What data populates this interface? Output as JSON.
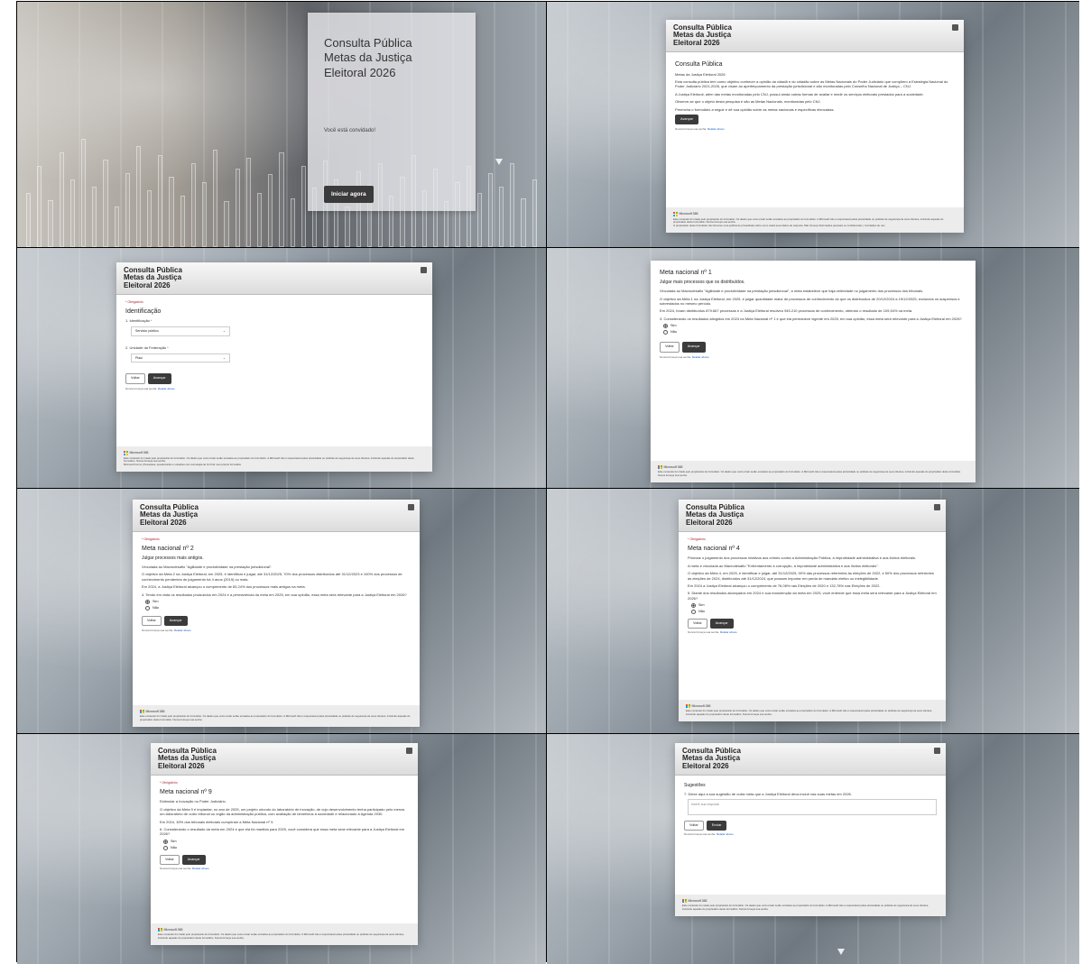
{
  "form": {
    "title_lines": [
      "Consulta Pública",
      "Metas da Justiça",
      "Eleitoral 2026"
    ],
    "cover_title": "Consulta Pública Metas da Justiça Eleitoral 2026",
    "invite": "Você está convidado!",
    "start_button": "Iniciar agora",
    "required_note": "* Obrigatório",
    "back_button": "Voltar",
    "next_button": "Avançar",
    "submit_button": "Enviar",
    "never_password": "Nunca forneça sua senha.",
    "report_abuse": "Relatar abuso",
    "yes": "Sim",
    "no": "Não"
  },
  "footer": {
    "brand": "Microsoft 365",
    "text1": "Este conteúdo foi criado pelo proprietário do formulário. Os dados que você enviar serão enviados ao proprietário do formulário. A Microsoft não é responsável pelas privacidade ou práticas de segurança de seus clientes, incluindo aquelas do proprietário deste formulário. Nunca forneça sua senha.",
    "text2": "Microsoft Forms | Pesquisas, questionários e votações com tecnologia de IA Criar meu próprio formulário",
    "text3": "O proprietário deste formulário não forneceu uma política de privacidade sobre como usará seus dados de resposta. Não forneça informações pessoais ou confidenciais. | Condições de uso"
  },
  "intro": {
    "heading": "Consulta Pública",
    "subheading": "Metas da Justiça Eleitoral 2026",
    "p1": "Esta consulta pública tem como objetivo conhecer a opinião da cidadã e do cidadão sobre as Metas Nacionais do Poder Judiciário que compõem a Estratégia Nacional do Poder Judiciário 2021-2026, que visam ao aperfeiçoamento da prestação jurisdicional e são monitoradas pelo Conselho Nacional de Justiça – CNJ.",
    "p2": "A Justiça Eleitoral, além das metas monitoradas pelo CNJ, possui ainda outras formas de avaliar e medir os serviços eleitorais prestados para a sociedade.",
    "p3": "Observe-se que o objeto desta pesquisa é são as Metas Nacionais, monitoradas pelo CNJ.",
    "p4": "Preencha o formulário a seguir e dê sua opinião sobre as metas nacionais e específicas elencadas."
  },
  "identification": {
    "heading": "Identificação",
    "q1": "1. Identificação",
    "q1_value": "Servidor público",
    "q2": "2. Unidade da Federação",
    "q2_value": "Piauí"
  },
  "meta1": {
    "heading": "Meta nacional nº 1",
    "subtitle": "Julgar mais processos que os distribuídos.",
    "p1": "Vinculada ao Macrodesafio \"Agilidade e produtividade na prestação jurisdicional\", a meta estabelece que haja celeridade no julgamento dos processos dos tribunais.",
    "p2": "O objetivo da Meta 1 na Justiça Eleitoral, em 2025, é julgar quantidade maior de processos de conhecimento do que os distribuídos de 20/12/2024 a 19/12/2025, excluídos os suspensos e sobrestados no mesmo período.",
    "p3": "Em 2024, foram distribuídos 879.667 processos e a Justiça Eleitoral resolveu 945.210 processos de conhecimento, obtendo o resultado de 109,54% na meta.",
    "q": "3. Considerando os resultados atingidos em 2024 na Meta Nacional nº 1 e que ela permanece vigente em 2025, em sua opinião, essa meta será relevante para a Justiça Eleitoral em 2026?"
  },
  "meta2": {
    "heading": "Meta nacional nº 2",
    "subtitle": "Julgar processos mais antigos.",
    "p1": "Vinculada ao Macrodesafio \"Agilidade e produtividade na prestação jurisdicional\".",
    "p2": "O objetivo da Meta 2 na Justiça Eleitoral, em 2025, é identificar e julgar, até 31/12/2025, 70% dos processos distribuídos até 31/12/2023 e 100% dos processos de conhecimento pendentes de julgamento há 4 anos (2019) ou mais.",
    "p3": "Em 2024, a Justiça Eleitoral alcançou o cumprimento de 83,24% dos processos mais antigos na meta.",
    "q": "4. Tendo em vista os resultados produzidos em 2024 e a permanência da meta em 2025, em sua opinião, essa meta será relevante para a Justiça Eleitoral em 2026?"
  },
  "meta4": {
    "heading": "Meta nacional nº 4",
    "p1": "Priorizar o julgamento dos processos relativos aos crimes contra a Administração Pública, à improbidade administrativa e aos ilícitos eleitorais.",
    "p2": "A meta é vinculada ao Macrodesafio \"Enfrentamento à corrupção, à improbidade administrativa e aos ilícitos eleitorais\".",
    "p3": "O objetivo da Meta 4, em 2025, é identificar e julgar, até 31/12/2025, 90% das processos referentes às eleições de 2022, e 50% dos processos referentes às eleições de 2024, distribuídos até 31/12/2024, que possam importar em perda de mandato eletivo ou inelegibilidade.",
    "p4": "Em 2024 a Justiça Eleitoral alcançou o cumprimento de 76,08% nas Eleições de 2020 e 132,78% nas Eleições de 2022.",
    "q": "5. Diante dos resultados alcançados em 2024 e sua manutenção da meta em 2025, você entende que essa meta será relevante para a Justiça Eleitoral em 2026?"
  },
  "meta9": {
    "heading": "Meta nacional nº 9",
    "p0": "Estimular a Inovação no Poder Judiciário.",
    "p1": "O objetivo da Meta 9 é implantar, no ano de 2025, um projeto oriundo do laboratório de inovação, de cujo desenvolvimento tenha participado pelo menos um laboratório de outro tribunal ou órgão da administração pública, com avaliação de benefícios à sociedade e relacionado à Agenda 2030.",
    "p2": "Em 2024, 30% dos tribunais eleitorais cumpriram a Meta Nacional nº 9.",
    "q": "6. Considerando o resultado da meta em 2024 e que ela foi mantida para 2025, você considera que essa meta será relevante para a Justiça Eleitoral em 2026?"
  },
  "suggestions": {
    "heading": "Sugestões",
    "q": "7. Deixe aqui a sua sugestão de outra meta que a Justiça Eleitoral deva incluir nas suas metas em 2026.",
    "placeholder": "Inserir sua resposta"
  }
}
